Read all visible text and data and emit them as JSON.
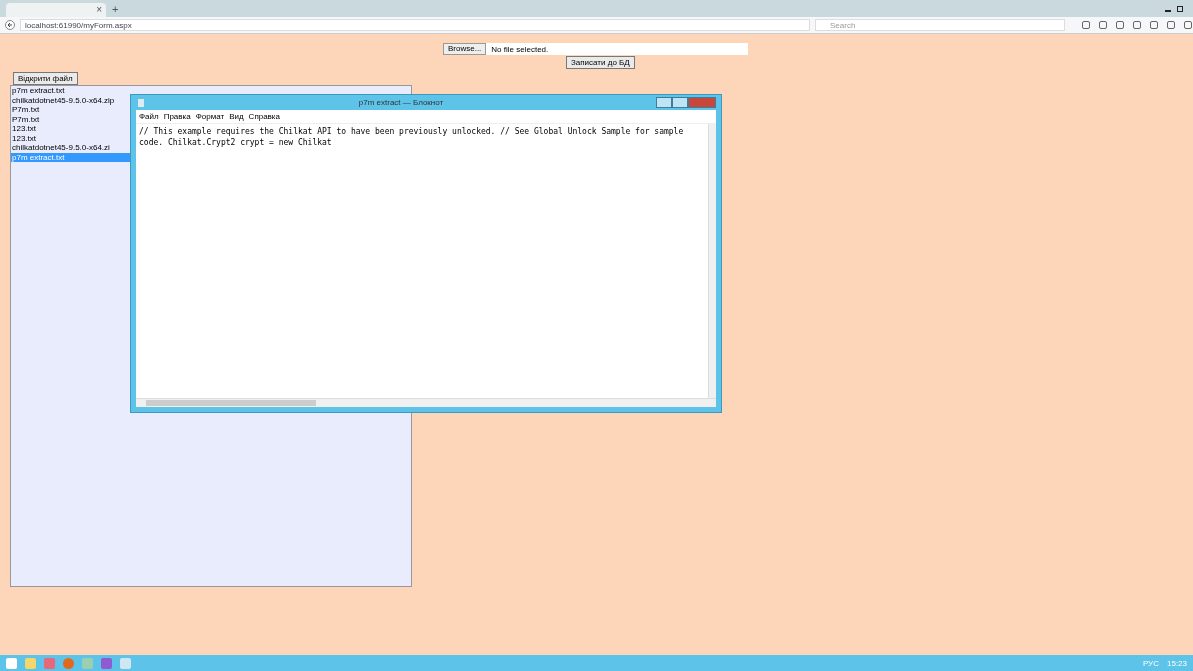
{
  "browser": {
    "tab_close": "×",
    "new_tab": "+",
    "url": "localhost:61990/myForm.aspx",
    "search_placeholder": "Search"
  },
  "page": {
    "file_input": {
      "button": "Browse...",
      "value": "No file selected."
    },
    "save_button": "Записати до БД",
    "open_button": "Відкрити файл",
    "files": [
      {
        "name": "p7m extract.txt",
        "selected": false
      },
      {
        "name": "chilkatdotnet45-9.5.0-x64.zip",
        "selected": false
      },
      {
        "name": "P7m.txt",
        "selected": false
      },
      {
        "name": "P7m.txt",
        "selected": false
      },
      {
        "name": "123.txt",
        "selected": false
      },
      {
        "name": "123.txt",
        "selected": false
      },
      {
        "name": "chilkatdotnet45-9.5.0-x64.zi",
        "selected": false
      },
      {
        "name": "p7m extract.txt",
        "selected": true
      }
    ]
  },
  "notepad": {
    "title": "p7m extract — Блокнот",
    "menu": [
      "Файл",
      "Правка",
      "Формат",
      "Вид",
      "Справка"
    ],
    "text": "// This example requires the Chilkat API to have been previously unlocked. // See Global Unlock Sample for sample code. Chilkat.Crypt2 crypt = new Chilkat"
  },
  "taskbar": {
    "tray_lang": "РУС",
    "clock": "15:23"
  }
}
